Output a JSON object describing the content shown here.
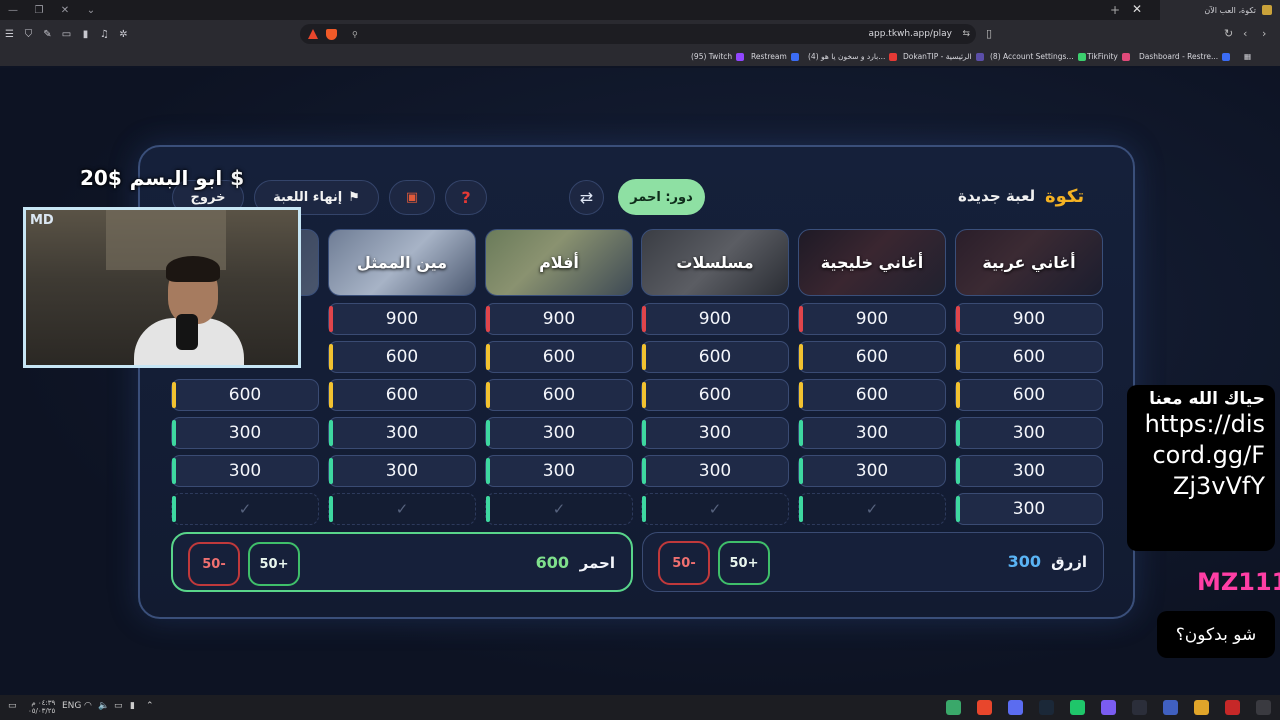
{
  "browser": {
    "tab_title": "تكوة، العب الآن",
    "url": "app.tkwh.app/play",
    "bookmarks": [
      "(95) Twitch",
      "Restream",
      "(4) بارد و سخون يا هو...",
      "DokanTIP - الرئيسية",
      "(8) Account Settings...",
      "TikFinity",
      "Dashboard - Restre..."
    ]
  },
  "game": {
    "brand": "تكوة",
    "new_game": "لعبة جديدة",
    "turn_label": "دور: احمر",
    "end_game": "إنهاء اللعبة",
    "exit": "خروج",
    "categories": [
      "أغاني عربية",
      "أغاني خليجية",
      "مسلسلات",
      "أفلام",
      "مين الممثل",
      ""
    ],
    "columns": [
      [
        "900",
        "600",
        "600",
        "300",
        "300",
        "300"
      ],
      [
        "900",
        "600",
        "600",
        "300",
        "300",
        "✓"
      ],
      [
        "900",
        "600",
        "600",
        "300",
        "300",
        "✓"
      ],
      [
        "900",
        "600",
        "600",
        "300",
        "300",
        "✓"
      ],
      [
        "900",
        "600",
        "600",
        "300",
        "300",
        "✓"
      ],
      [
        "",
        "",
        "600",
        "300",
        "300",
        "✓"
      ]
    ],
    "teams": {
      "blue": {
        "name": "ازرق",
        "score": "300",
        "plus": "50+",
        "minus": "50-"
      },
      "red": {
        "name": "احمر",
        "score": "600",
        "plus": "50+",
        "minus": "50-"
      }
    },
    "accent_colors": {
      "900": "#e0454b",
      "600": "#f2c230",
      "300": "#3ed8a0",
      "done": "#3ed8a0"
    }
  },
  "overlay": {
    "donor_name": "ابو البسم",
    "donor_amount": "20$",
    "donor_symbol": "$",
    "cam_logo": "MD",
    "chat_greeting": "حياك الله معنا",
    "chat_url": "https://discord.gg/FZj3vVfY",
    "chat_user": "MZ111",
    "chat_message": "شو بدكون؟"
  },
  "taskbar": {
    "lang": "ENG",
    "time": "٠٤:٣٩ م",
    "date": "٠٥/٠٣/٢٥"
  }
}
